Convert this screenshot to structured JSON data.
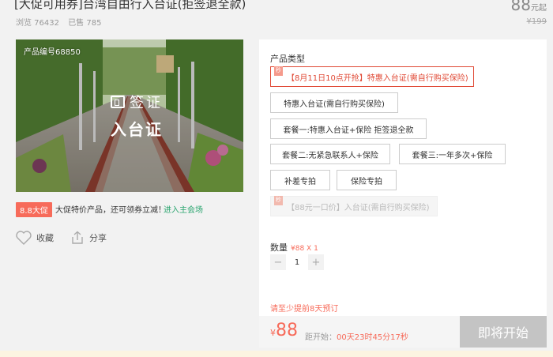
{
  "header": {
    "title": "[大促可用券]台湾自由行入台证(拒签退全款)",
    "views": "浏览 76432",
    "sold": "已售 785",
    "price": "88",
    "price_unit": "元起",
    "original_price": "¥199"
  },
  "gallery": {
    "product_no": "产品编号68850",
    "overlay_line1": "签证",
    "overlay_line2": "入台证"
  },
  "promo": {
    "badge": "8.8大促",
    "text": "大促特价产品，还可领券立减！",
    "link": "进入主会场"
  },
  "social": {
    "favorite": "收藏",
    "share": "分享"
  },
  "product_type": {
    "label": "产品类型",
    "tag": "秒",
    "options": [
      "【8月11日10点开抢】特惠入台证(需自行购买保险)",
      "特惠入台证(需自行购买保险)",
      "套餐一:特惠入台证+保险 拒签退全款",
      "套餐二:无紧急联系人+保险",
      "套餐三:一年多次+保险",
      "补差专拍",
      "保险专拍",
      "【88元一口价】入台证(需自行购买保险)"
    ]
  },
  "quantity": {
    "label": "数量",
    "unit_price": "¥88 X 1",
    "minus": "−",
    "value": "1",
    "plus": "+"
  },
  "notice": "请至少提前8天预订",
  "buy": {
    "currency": "¥",
    "price": "88",
    "countdown_label": "距开始：",
    "countdown_value": "00天23时45分17秒",
    "button": "即将开始"
  },
  "colors": {
    "accent": "#f76b5a",
    "selected_border": "#e04a36",
    "link_green": "#2ba56f",
    "disabled_button": "#c4c4c4"
  }
}
